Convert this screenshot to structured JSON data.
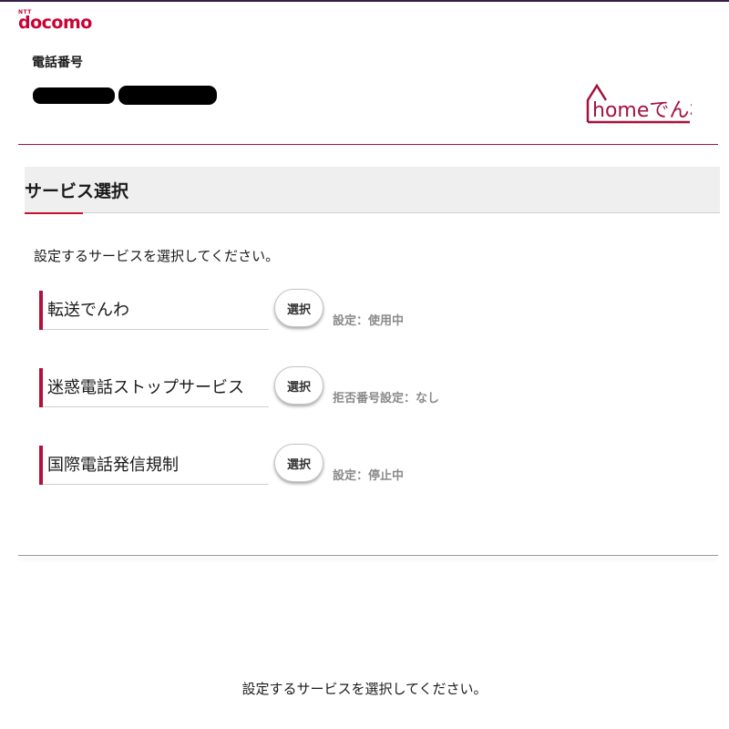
{
  "header": {
    "brand_small": "NTT",
    "brand": "docomo",
    "phone_label": "電話番号",
    "service_logo_text": "homeでんわ"
  },
  "section": {
    "title": "サービス選択",
    "instruction": "設定するサービスを選択してください。"
  },
  "services": [
    {
      "name": "転送でんわ",
      "button_label": "選択",
      "status": "設定：使用中"
    },
    {
      "name": "迷惑電話ストップサービス",
      "button_label": "選択",
      "status": "拒否番号設定：なし"
    },
    {
      "name": "国際電話発信規制",
      "button_label": "選択",
      "status": "設定：停止中"
    }
  ],
  "footer": {
    "message": "設定するサービスを選択してください。"
  },
  "colors": {
    "brand_red": "#cc0033",
    "accent_crimson": "#b0123c",
    "top_line": "#3a1d4d"
  }
}
